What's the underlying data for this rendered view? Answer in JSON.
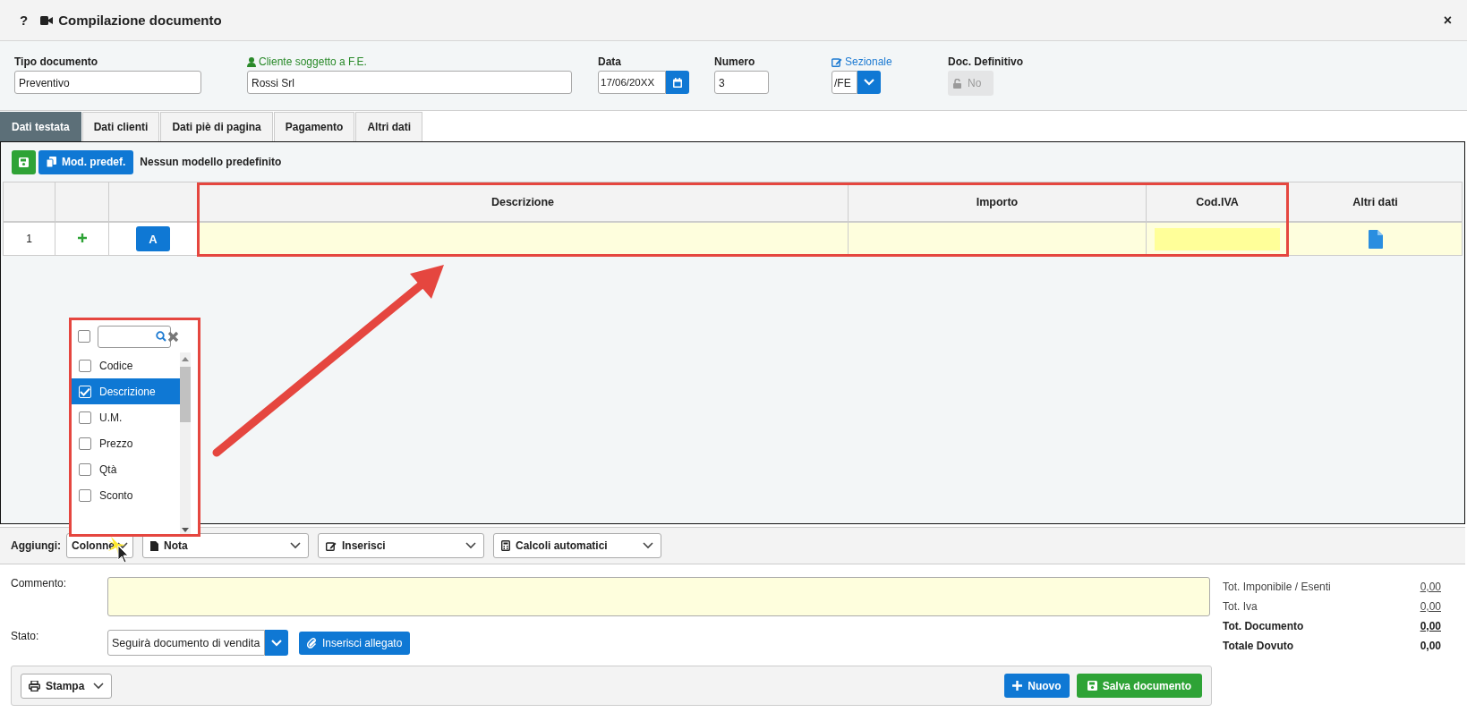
{
  "window": {
    "help": "?",
    "title": "Compilazione documento",
    "close": "×"
  },
  "header_fields": [
    {
      "kind": "text",
      "label": "Tipo documento",
      "value": "Preventivo"
    },
    {
      "kind": "client",
      "label": "Cliente soggetto a F.E.",
      "value": "Rossi Srl"
    },
    {
      "kind": "date",
      "label": "Data",
      "value": "17/06/20XX"
    },
    {
      "kind": "number",
      "label": "Numero",
      "value": "3"
    },
    {
      "kind": "select",
      "label": "Sezionale",
      "value": "/FE"
    },
    {
      "kind": "toggle",
      "label": "Doc. Definitivo",
      "value": "No",
      "disabled": true
    }
  ],
  "tabs": [
    {
      "label": "Dati testata",
      "selected": true
    },
    {
      "label": "Dati clienti",
      "selected": false
    },
    {
      "label": "Dati piè di pagina",
      "selected": false
    },
    {
      "label": "Pagamento",
      "selected": false
    },
    {
      "label": "Altri dati",
      "selected": false
    }
  ],
  "toolbar": {
    "model_button": "Mod. predef.",
    "model_status": "Nessun modello predefinito"
  },
  "table": {
    "columns": [
      "Descrizione",
      "Importo",
      "Cod.IVA",
      "Altri dati"
    ],
    "rows": [
      {
        "number": "1",
        "action": "A"
      }
    ]
  },
  "column_picker": {
    "select_all": {
      "checked": false
    },
    "items": [
      {
        "label": "Codice",
        "checked": false,
        "selected": false
      },
      {
        "label": "Descrizione",
        "checked": true,
        "selected": true
      },
      {
        "label": "U.M.",
        "checked": false,
        "selected": false
      },
      {
        "label": "Prezzo",
        "checked": false,
        "selected": false
      },
      {
        "label": "Qtà",
        "checked": false,
        "selected": false
      },
      {
        "label": "Sconto",
        "checked": false,
        "selected": false
      }
    ]
  },
  "add_bar": {
    "label": "Aggiungi:",
    "menus": [
      {
        "kind": "columns",
        "label": "Colonne"
      },
      {
        "kind": "note",
        "label": "Nota"
      },
      {
        "kind": "insert",
        "label": "Inserisci"
      },
      {
        "kind": "calc",
        "label": "Calcoli automatici"
      }
    ]
  },
  "comment": {
    "label": "Commento:"
  },
  "status": {
    "label": "Stato:",
    "value": "Seguirà documento di vendita",
    "attach_button": "Inserisci allegato"
  },
  "footer": {
    "print": "Stampa",
    "new": "Nuovo",
    "save": "Salva documento"
  },
  "totals": [
    {
      "label": "Tot. Imponibile / Esenti",
      "value": "0,00",
      "bold": false,
      "underlined": true
    },
    {
      "label": "Tot. Iva",
      "value": "0,00",
      "bold": false,
      "underlined": true
    },
    {
      "label": "Tot. Documento",
      "value": "0,00",
      "bold": true,
      "underlined": true
    },
    {
      "label": "Totale Dovuto",
      "value": "0,00",
      "bold": true,
      "underlined": false
    }
  ]
}
